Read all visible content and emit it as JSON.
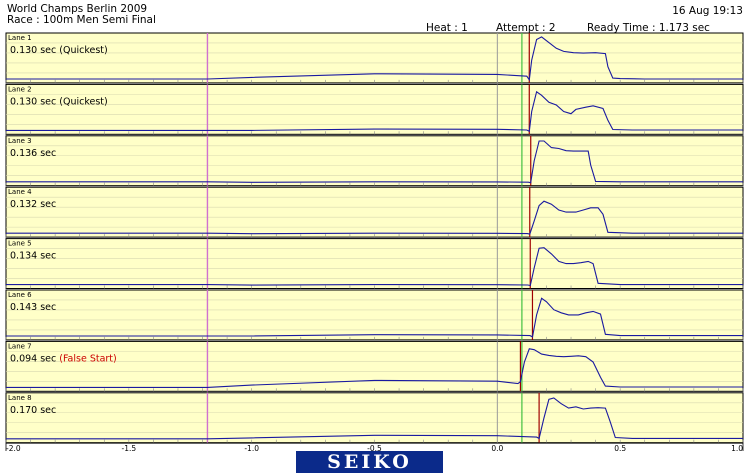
{
  "header": {
    "event": "World Champs Berlin 2009",
    "race": "Race : 100m Men Semi Final",
    "datetime": "16 Aug 19:13",
    "heat": "Heat : 1",
    "attempt": "Attempt : 2",
    "ready_time": "Ready Time : 1.173 sec"
  },
  "colors": {
    "panel_bg": "#ffffc8",
    "trace": "#1a1aa0",
    "magenta_marker": "#d070d0",
    "gray_marker": "#9a9a9a",
    "green_marker": "#40c040",
    "red_marker": "#a00000",
    "false_start_text": "#cc0000"
  },
  "chart_data": {
    "type": "line",
    "xlim": [
      -2.0,
      1.0
    ],
    "xticks": [
      -2.0,
      -1.5,
      -1.0,
      -0.5,
      0.0,
      0.5,
      1.0
    ],
    "xtick_labels": [
      "-2.0",
      "-1.5",
      "-1.0",
      "-0.5",
      "0.0",
      "0.5",
      "1.0"
    ],
    "markers": {
      "magenta": -1.18,
      "gray": 0.0,
      "green": 0.1
    },
    "lanes": [
      {
        "label": "Lane 1",
        "reaction": "0.130 sec",
        "note": "(Quickest)",
        "false_start": false,
        "reaction_value": 0.13,
        "pre_level": 0.14,
        "trace": [
          [
            0.13,
            0
          ],
          [
            0.14,
            0.45
          ],
          [
            0.16,
            0.92
          ],
          [
            0.18,
            0.98
          ],
          [
            0.21,
            0.85
          ],
          [
            0.24,
            0.72
          ],
          [
            0.27,
            0.65
          ],
          [
            0.31,
            0.62
          ],
          [
            0.35,
            0.61
          ],
          [
            0.4,
            0.62
          ],
          [
            0.44,
            0.6
          ],
          [
            0.45,
            0.3
          ],
          [
            0.47,
            0.04
          ],
          [
            0.5,
            0.03
          ],
          [
            0.6,
            0.02
          ],
          [
            1.0,
            0.02
          ]
        ]
      },
      {
        "label": "Lane 2",
        "reaction": "0.130 sec",
        "note": "(Quickest)",
        "false_start": false,
        "reaction_value": 0.13,
        "pre_level": 0.05,
        "trace": [
          [
            0.13,
            0
          ],
          [
            0.14,
            0.45
          ],
          [
            0.16,
            0.9
          ],
          [
            0.18,
            0.82
          ],
          [
            0.21,
            0.66
          ],
          [
            0.24,
            0.6
          ],
          [
            0.27,
            0.45
          ],
          [
            0.3,
            0.4
          ],
          [
            0.32,
            0.5
          ],
          [
            0.36,
            0.55
          ],
          [
            0.39,
            0.58
          ],
          [
            0.43,
            0.52
          ],
          [
            0.45,
            0.25
          ],
          [
            0.47,
            0.04
          ],
          [
            0.55,
            0.03
          ],
          [
            1.0,
            0.03
          ]
        ]
      },
      {
        "label": "Lane 3",
        "reaction": "0.136 sec",
        "note": "",
        "false_start": false,
        "reaction_value": 0.136,
        "pre_level": 0.02,
        "trace": [
          [
            0.136,
            0
          ],
          [
            0.15,
            0.5
          ],
          [
            0.17,
            0.95
          ],
          [
            0.19,
            0.95
          ],
          [
            0.22,
            0.8
          ],
          [
            0.25,
            0.78
          ],
          [
            0.28,
            0.73
          ],
          [
            0.31,
            0.72
          ],
          [
            0.34,
            0.72
          ],
          [
            0.37,
            0.72
          ],
          [
            0.38,
            0.4
          ],
          [
            0.4,
            0.03
          ],
          [
            0.5,
            0.02
          ],
          [
            1.0,
            0.02
          ]
        ]
      },
      {
        "label": "Lane 4",
        "reaction": "0.132 sec",
        "note": "",
        "false_start": false,
        "reaction_value": 0.132,
        "pre_level": 0.02,
        "trace": [
          [
            0.132,
            0
          ],
          [
            0.15,
            0.3
          ],
          [
            0.17,
            0.65
          ],
          [
            0.19,
            0.75
          ],
          [
            0.22,
            0.68
          ],
          [
            0.25,
            0.55
          ],
          [
            0.28,
            0.5
          ],
          [
            0.32,
            0.5
          ],
          [
            0.35,
            0.55
          ],
          [
            0.38,
            0.6
          ],
          [
            0.41,
            0.6
          ],
          [
            0.43,
            0.45
          ],
          [
            0.45,
            0.04
          ],
          [
            0.55,
            0.02
          ],
          [
            1.0,
            0.02
          ]
        ]
      },
      {
        "label": "Lane 5",
        "reaction": "0.134 sec",
        "note": "",
        "false_start": false,
        "reaction_value": 0.134,
        "pre_level": 0.02,
        "trace": [
          [
            0.134,
            0
          ],
          [
            0.15,
            0.4
          ],
          [
            0.17,
            0.85
          ],
          [
            0.19,
            0.86
          ],
          [
            0.22,
            0.72
          ],
          [
            0.25,
            0.55
          ],
          [
            0.28,
            0.5
          ],
          [
            0.31,
            0.5
          ],
          [
            0.34,
            0.52
          ],
          [
            0.37,
            0.55
          ],
          [
            0.39,
            0.5
          ],
          [
            0.41,
            0.05
          ],
          [
            0.5,
            0.02
          ],
          [
            1.0,
            0.02
          ]
        ]
      },
      {
        "label": "Lane 6",
        "reaction": "0.143 sec",
        "note": "",
        "false_start": false,
        "reaction_value": 0.143,
        "pre_level": 0.05,
        "trace": [
          [
            0.143,
            0
          ],
          [
            0.16,
            0.5
          ],
          [
            0.18,
            0.88
          ],
          [
            0.2,
            0.8
          ],
          [
            0.23,
            0.62
          ],
          [
            0.26,
            0.55
          ],
          [
            0.29,
            0.5
          ],
          [
            0.33,
            0.5
          ],
          [
            0.36,
            0.55
          ],
          [
            0.39,
            0.58
          ],
          [
            0.42,
            0.52
          ],
          [
            0.44,
            0.06
          ],
          [
            0.5,
            0.03
          ],
          [
            1.0,
            0.03
          ]
        ]
      },
      {
        "label": "Lane 7",
        "reaction": "0.094 sec",
        "note": "(False Start)",
        "false_start": true,
        "reaction_value": 0.094,
        "pre_level": 0.18,
        "trace": [
          [
            0.094,
            0.15
          ],
          [
            0.11,
            0.6
          ],
          [
            0.13,
            0.9
          ],
          [
            0.15,
            0.88
          ],
          [
            0.18,
            0.78
          ],
          [
            0.21,
            0.75
          ],
          [
            0.24,
            0.73
          ],
          [
            0.27,
            0.72
          ],
          [
            0.3,
            0.73
          ],
          [
            0.33,
            0.74
          ],
          [
            0.36,
            0.72
          ],
          [
            0.39,
            0.6
          ],
          [
            0.42,
            0.25
          ],
          [
            0.44,
            0.05
          ],
          [
            0.5,
            0.03
          ],
          [
            1.0,
            0.03
          ]
        ]
      },
      {
        "label": "Lane 8",
        "reaction": "0.170 sec",
        "note": "",
        "false_start": false,
        "reaction_value": 0.17,
        "pre_level": 0.1,
        "trace": [
          [
            0.17,
            0.03
          ],
          [
            0.19,
            0.5
          ],
          [
            0.21,
            0.92
          ],
          [
            0.23,
            0.95
          ],
          [
            0.26,
            0.82
          ],
          [
            0.29,
            0.72
          ],
          [
            0.32,
            0.75
          ],
          [
            0.35,
            0.7
          ],
          [
            0.38,
            0.72
          ],
          [
            0.41,
            0.73
          ],
          [
            0.44,
            0.72
          ],
          [
            0.46,
            0.4
          ],
          [
            0.48,
            0.05
          ],
          [
            0.55,
            0.03
          ],
          [
            1.0,
            0.03
          ]
        ]
      }
    ]
  },
  "footer": {
    "brand": "SEIKO"
  }
}
